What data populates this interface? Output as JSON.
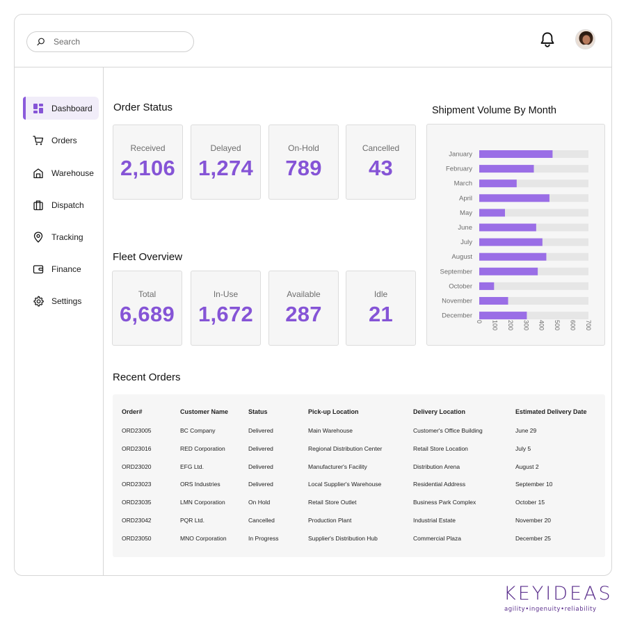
{
  "search": {
    "placeholder": "Search"
  },
  "sidebar": {
    "items": [
      {
        "label": "Dashboard",
        "icon": "dashboard-icon",
        "active": true
      },
      {
        "label": "Orders",
        "icon": "cart-icon"
      },
      {
        "label": "Warehouse",
        "icon": "warehouse-icon"
      },
      {
        "label": "Dispatch",
        "icon": "briefcase-icon"
      },
      {
        "label": "Tracking",
        "icon": "location-pin-icon"
      },
      {
        "label": "Finance",
        "icon": "wallet-icon"
      },
      {
        "label": "Settings",
        "icon": "gear-icon"
      }
    ]
  },
  "order_status": {
    "title": "Order Status",
    "cards": [
      {
        "label": "Received",
        "value": "2,106"
      },
      {
        "label": "Delayed",
        "value": "1,274"
      },
      {
        "label": "On-Hold",
        "value": "789"
      },
      {
        "label": "Cancelled",
        "value": "43"
      }
    ]
  },
  "fleet_overview": {
    "title": "Fleet Overview",
    "cards": [
      {
        "label": "Total",
        "value": "6,689"
      },
      {
        "label": "In-Use",
        "value": "1,672"
      },
      {
        "label": "Available",
        "value": "287"
      },
      {
        "label": "Idle",
        "value": "21"
      }
    ]
  },
  "chart_title": "Shipment Volume By Month",
  "chart_data": {
    "type": "bar",
    "orientation": "horizontal",
    "title": "Shipment Volume By Month",
    "categories": [
      "January",
      "February",
      "March",
      "April",
      "May",
      "June",
      "July",
      "August",
      "September",
      "October",
      "November",
      "December"
    ],
    "values": [
      470,
      350,
      240,
      450,
      165,
      365,
      405,
      430,
      375,
      95,
      185,
      305
    ],
    "xlim": [
      0,
      700
    ],
    "x_ticks": [
      "0",
      "100",
      "200",
      "300",
      "400",
      "500",
      "600",
      "700"
    ],
    "grid": false,
    "bar_color": "#9a6ee6",
    "track_color": "#e6e6e6"
  },
  "recent_orders": {
    "title": "Recent Orders",
    "columns": [
      "Order#",
      "Customer Name",
      "Status",
      "Pick-up Location",
      "Delivery Location",
      "Estimated Delivery Date"
    ],
    "rows": [
      [
        "ORD23005",
        "BC Company",
        "Delivered",
        "Main Warehouse",
        "Customer's Office Building",
        "June 29"
      ],
      [
        "ORD23016",
        "RED Corporation",
        "Delivered",
        "Regional Distribution Center",
        "Retail Store Location",
        "July 5"
      ],
      [
        "ORD23020",
        "EFG Ltd.",
        "Delivered",
        "Manufacturer's Facility",
        "Distribution Arena",
        "August 2"
      ],
      [
        "ORD23023",
        "ORS Industries",
        "Delivered",
        "Local Supplier's Warehouse",
        "Residential Address",
        "September 10"
      ],
      [
        "ORD23035",
        "LMN Corporation",
        "On Hold",
        "Retail Store Outlet",
        "Business Park Complex",
        "October 15"
      ],
      [
        "ORD23042",
        "PQR Ltd.",
        "Cancelled",
        "Production Plant",
        "Industrial Estate",
        "November 20"
      ],
      [
        "ORD23050",
        "MNO Corporation",
        "In Progress",
        "Supplier's Distribution Hub",
        "Commercial Plaza",
        "December 25"
      ]
    ]
  },
  "brand": {
    "name": "KEYIDEAS",
    "tagline": "agility•ingenuity•reliability"
  },
  "colors": {
    "accent": "#8554d6",
    "active_bg": "#f1edf9",
    "card_bg": "#f6f6f6"
  }
}
